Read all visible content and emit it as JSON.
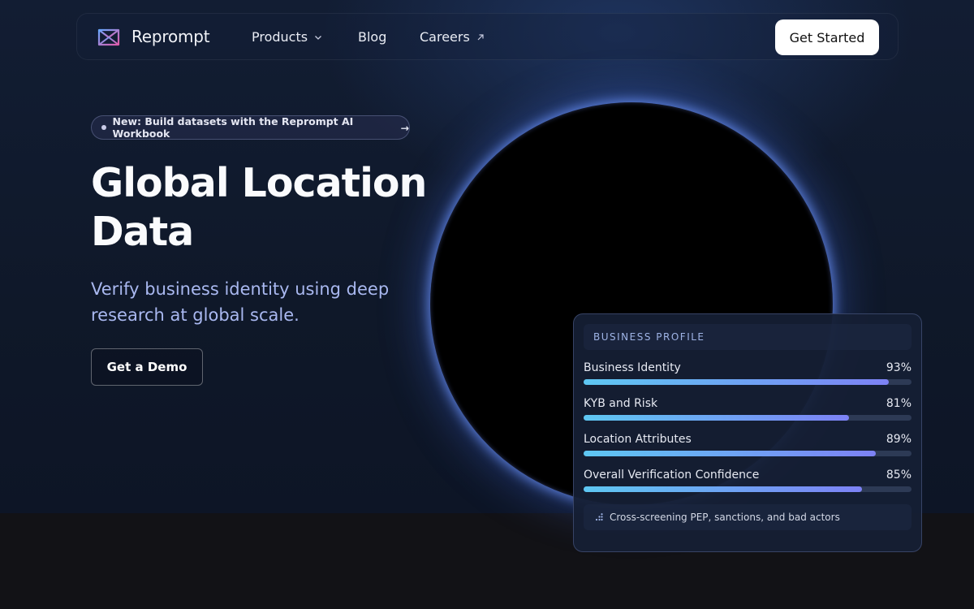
{
  "nav": {
    "brand": "Reprompt",
    "links": [
      {
        "label": "Products"
      },
      {
        "label": "Blog"
      },
      {
        "label": "Careers"
      }
    ],
    "cta": "Get Started"
  },
  "hero": {
    "badge": "New: Build datasets with the Reprompt AI Workbook",
    "badge_arrow": "→",
    "headline_line1": "Global Location",
    "headline_line2": "Data",
    "subhead": "Verify business identity using deep research at global scale.",
    "cta": "Get a Demo"
  },
  "card": {
    "title": "BUSINESS PROFILE",
    "metrics": [
      {
        "label": "Business Identity",
        "value": "93%",
        "fraction": 0.93
      },
      {
        "label": "KYB and Risk",
        "value": "81%",
        "fraction": 0.81
      },
      {
        "label": "Location Attributes",
        "value": "89%",
        "fraction": 0.89
      },
      {
        "label": "Overall Verification Confidence",
        "value": "85%",
        "fraction": 0.85
      }
    ],
    "footer": "Cross-screening PEP, sanctions, and bad actors"
  },
  "colors": {
    "accent_start": "#5ec7f2",
    "accent_end": "#7d82f5",
    "subhead": "#a9b8f0"
  },
  "icons": {
    "logo": "reprompt-logo-icon",
    "products_chevron": "chevron-down-icon",
    "careers_external": "external-link-icon",
    "footer": "scan-dots-icon"
  }
}
